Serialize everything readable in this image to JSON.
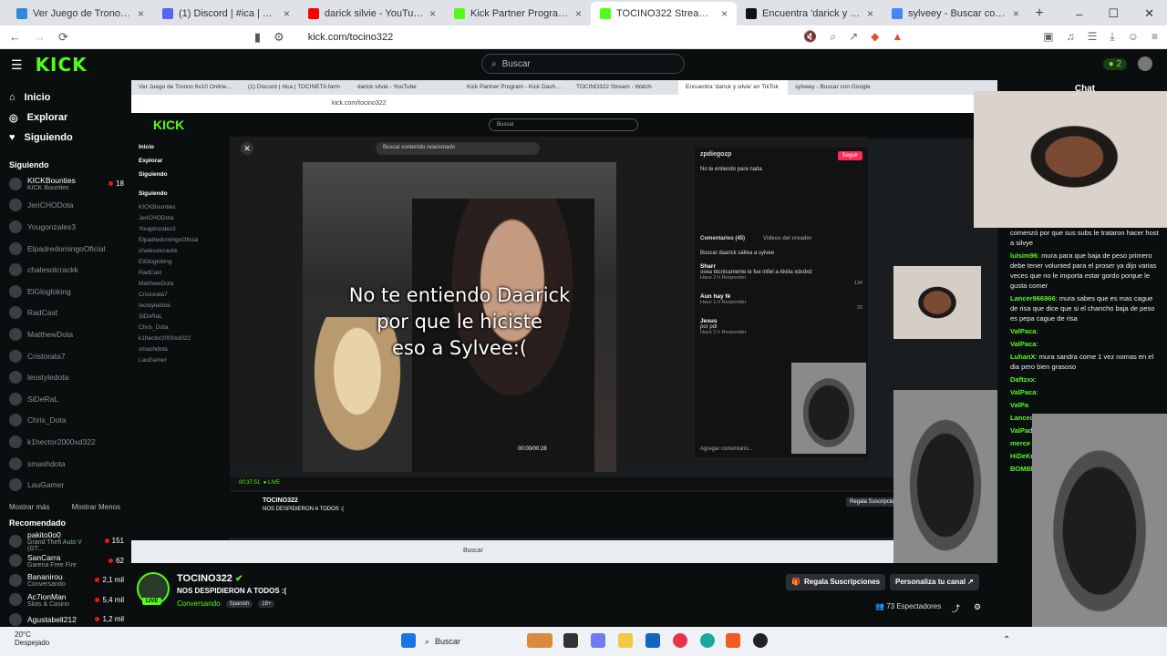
{
  "browser": {
    "tabs": [
      {
        "title": "Ver Juego de Tronos 6x10 Online Gra",
        "color": "#2f8ad8"
      },
      {
        "title": "(1) Discord | #ica | TOCINETA farm",
        "color": "#5865f2"
      },
      {
        "title": "darick silvie - YouTube",
        "color": "#ff0000"
      },
      {
        "title": "Kick Partner Program - Kick Dashboa",
        "color": "#53fc18"
      },
      {
        "title": "TOCINO322 Stream - Watch",
        "color": "#53fc18",
        "active": true
      },
      {
        "title": "Encuentra 'darick y silvie' en TikTok",
        "color": "#111111"
      },
      {
        "title": "sylveey - Buscar con Google",
        "color": "#4285f4"
      }
    ],
    "url": "kick.com/tocino322"
  },
  "kick": {
    "logo": "KICK",
    "search_placeholder": "Buscar",
    "points": "2",
    "nav": [
      "Inicio",
      "Explorar",
      "Siguiendo"
    ],
    "following_title": "Siguiendo",
    "following": [
      {
        "name": "KICKBounties",
        "sub": "KICK Bounties",
        "count": "18"
      },
      {
        "name": "JeriCHODota"
      },
      {
        "name": "Yougonzales3"
      },
      {
        "name": "ElpadredomingoOficial"
      },
      {
        "name": "chalesolcrackk"
      },
      {
        "name": "ElGlogloking"
      },
      {
        "name": "RadCast"
      },
      {
        "name": "MatthewDota"
      },
      {
        "name": "Cristorata7"
      },
      {
        "name": "leostyledota"
      },
      {
        "name": "SiDeRaL"
      },
      {
        "name": "Chris_Dota"
      },
      {
        "name": "k1hector2000xd322"
      },
      {
        "name": "smashdota"
      },
      {
        "name": "LauGamer"
      }
    ],
    "show_more": "Mostrar más",
    "show_less": "Mostrar Menos",
    "recommended_title": "Recomendado",
    "recommended": [
      {
        "name": "pakito0o0",
        "sub": "Grand Theft Auto V (GT...",
        "count": "151"
      },
      {
        "name": "SanCarra",
        "sub": "Garena Free Fire",
        "count": "62"
      },
      {
        "name": "Bananirou",
        "sub": "Conversando",
        "count": "2,1 mil"
      },
      {
        "name": "Ac7ionMan",
        "sub": "Slots & Casino",
        "count": "5,4 mil"
      },
      {
        "name": "Agustabell212",
        "sub": "",
        "count": "1,2 mil"
      }
    ]
  },
  "nested": {
    "tiktok": {
      "search": "Buscar contenido relacionado",
      "caption_lines": [
        "No te entiendo Daarick",
        "por que le hiciste",
        "eso a Sylvee:("
      ],
      "user": "zpdiegozp",
      "follow": "Seguir",
      "desc": "No te entiendo para nada",
      "comments_tab": "Comentarios (45)",
      "creator_tab": "Videos del creador",
      "search_hint": "Buscar daarick sáltea a sylvee",
      "time": "00:00/00:28",
      "comments": [
        {
          "user": "Sharr",
          "text": "osea técnicamente le fue infiel a Akiita xdxdxd",
          "meta": "Hace 2 h  Responder",
          "likes": "134"
        },
        {
          "user": "Aun hay fé",
          "text": "",
          "meta": "Hace 1 h  Responder",
          "likes": "20"
        },
        {
          "user": "Jesus",
          "text": "por pdl",
          "meta": "Hace 2 h  Responder",
          "likes": ""
        }
      ],
      "add_comment": "Agregar comentario..."
    },
    "player_time": "00:37:51",
    "player_live": "LIVE"
  },
  "chat": {
    "title": "Chat",
    "messages": [
      {
        "user": "",
        "text": "comenzó por que sus subs le trataron hacer host a silvye"
      },
      {
        "user": "luisim96",
        "text": ": mura para que baja de peso primero debe tener volunted para el proser ya dijo varias veces que no le importa estar gordo porque le gusta comer"
      },
      {
        "user": "Lancer966866",
        "text": ": mura sabes que es mas cague de risa que dice que si el chancho baja de peso es pepa cague de risa"
      },
      {
        "user": "ValPaca",
        "text": ":"
      },
      {
        "user": "ValPaca",
        "text": ":"
      },
      {
        "user": "LuhanX",
        "text": ": mura sandra come 1 vez nomas en el dia pero bien grasoso"
      },
      {
        "user": "Daftzxx",
        "text": ":"
      },
      {
        "user": "ValPaca",
        "text": ":"
      },
      {
        "user": "ValPa",
        "text": ""
      },
      {
        "user": "Lance",
        "text": "de risa es pep"
      },
      {
        "user": "ValPa",
        "text": "dice Y"
      },
      {
        "user": "merce",
        "text": ""
      },
      {
        "user": "HiDeK",
        "text": "mejor"
      },
      {
        "user": "BOMB",
        "text": "lustrar toche"
      }
    ]
  },
  "stream": {
    "name": "TOCINO322",
    "verified": "✔",
    "title": "NOS DESPIDIERON A TODOS :(",
    "category": "Conversando",
    "tags": [
      "Spanish",
      "18+"
    ],
    "live": "LIVE",
    "gift_button": "Regala Suscripciones",
    "customize_button": "Personaliza tu canal",
    "viewers": "73 Espectadores"
  },
  "taskbar": {
    "weather_temp": "20°C",
    "weather_desc": "Despejado",
    "search": "Buscar"
  },
  "colors": {
    "brand": "#53fc18",
    "live": "#e91916"
  }
}
